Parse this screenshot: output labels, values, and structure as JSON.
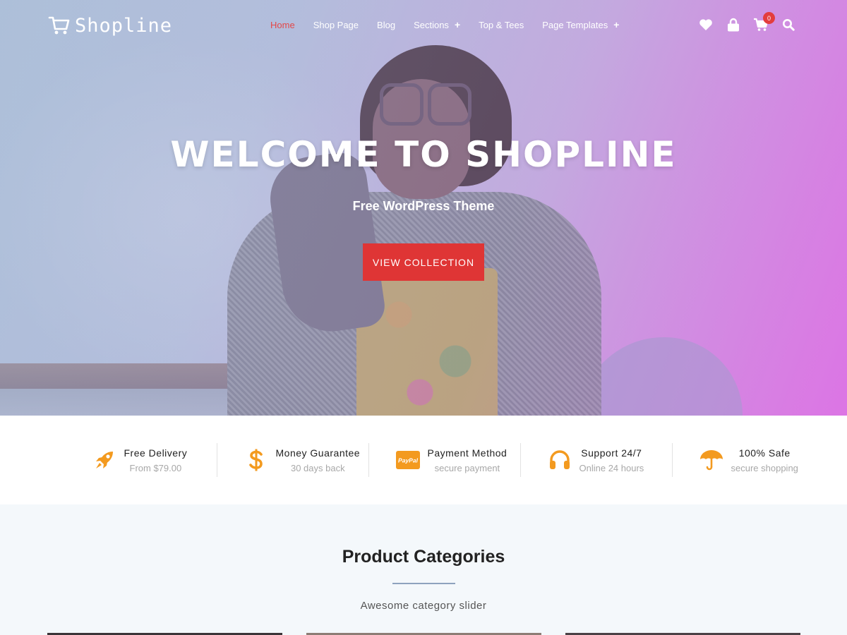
{
  "brand": {
    "name": "Shopline"
  },
  "nav": {
    "items": [
      {
        "label": "Home",
        "active": true,
        "has_submenu": false
      },
      {
        "label": "Shop Page",
        "active": false,
        "has_submenu": false
      },
      {
        "label": "Blog",
        "active": false,
        "has_submenu": false
      },
      {
        "label": "Sections",
        "active": false,
        "has_submenu": true
      },
      {
        "label": "Top & Tees",
        "active": false,
        "has_submenu": false
      },
      {
        "label": "Page Templates",
        "active": false,
        "has_submenu": true
      }
    ],
    "submenu_symbol": "+"
  },
  "header_icons": {
    "wishlist": "heart-icon",
    "account": "lock-icon",
    "cart": "cart-icon",
    "cart_count": "0",
    "search": "search-icon"
  },
  "hero": {
    "title": "WELCOME TO SHOPLINE",
    "subtitle": "Free WordPress Theme",
    "button_label": "VIEW COLLECTION"
  },
  "features": [
    {
      "icon": "rocket-icon",
      "title": "Free Delivery",
      "subtitle": "From $79.00"
    },
    {
      "icon": "dollar-icon",
      "title": "Money Guarantee",
      "subtitle": "30 days back"
    },
    {
      "icon": "paypal-icon",
      "icon_text": "PayPal",
      "title": "Payment Method",
      "subtitle": "secure payment"
    },
    {
      "icon": "headphones-icon",
      "title": "Support 24/7",
      "subtitle": "Online 24 hours"
    },
    {
      "icon": "umbrella-icon",
      "title": "100% Safe",
      "subtitle": "secure shopping"
    }
  ],
  "categories": {
    "title": "Product Categories",
    "subtitle": "Awesome category slider"
  },
  "colors": {
    "accent_red": "#df3535",
    "nav_active": "#e34848",
    "feature_icon_orange": "#f39a1f",
    "cart_badge": "#e33d3d"
  }
}
